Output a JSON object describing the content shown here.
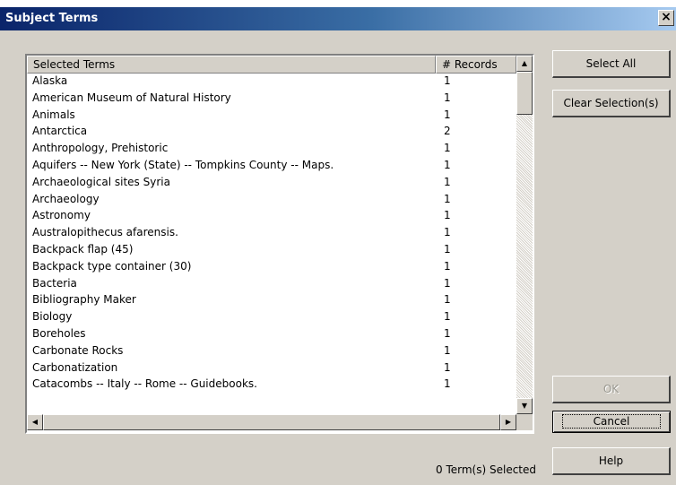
{
  "window": {
    "title": "Subject Terms",
    "close_glyph": "×"
  },
  "list": {
    "columns": [
      "Selected Terms",
      "# Records"
    ],
    "sort_glyph": "▲",
    "rows": [
      {
        "term": "Alaska",
        "count": "1"
      },
      {
        "term": "American Museum of Natural History",
        "count": "1"
      },
      {
        "term": "Animals",
        "count": "1"
      },
      {
        "term": "Antarctica",
        "count": "2"
      },
      {
        "term": "Anthropology, Prehistoric",
        "count": "1"
      },
      {
        "term": "Aquifers -- New York (State) -- Tompkins County -- Maps.",
        "count": "1"
      },
      {
        "term": "Archaeological sites Syria",
        "count": "1"
      },
      {
        "term": "Archaeology",
        "count": "1"
      },
      {
        "term": "Astronomy",
        "count": "1"
      },
      {
        "term": "Australopithecus afarensis.",
        "count": "1"
      },
      {
        "term": "Backpack flap (45)",
        "count": "1"
      },
      {
        "term": "Backpack type container (30)",
        "count": "1"
      },
      {
        "term": "Bacteria",
        "count": "1"
      },
      {
        "term": "Bibliography Maker",
        "count": "1"
      },
      {
        "term": "Biology",
        "count": "1"
      },
      {
        "term": "Boreholes",
        "count": "1"
      },
      {
        "term": "Carbonate Rocks",
        "count": "1"
      },
      {
        "term": "Carbonatization",
        "count": "1"
      },
      {
        "term": "Catacombs -- Italy -- Rome -- Guidebooks.",
        "count": "1"
      }
    ]
  },
  "scroll": {
    "up": "▲",
    "down": "▼",
    "left": "◀",
    "right": "▶"
  },
  "status": "0 Term(s) Selected",
  "buttons": {
    "select_all": "Select All",
    "clear": "Clear Selection(s)",
    "ok": "OK",
    "cancel": "Cancel",
    "help": "Help"
  }
}
